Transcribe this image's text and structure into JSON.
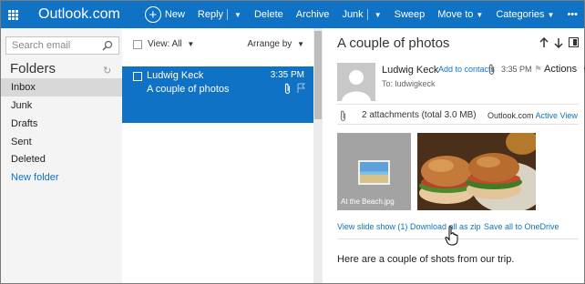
{
  "app": {
    "brand": "Outlook.com"
  },
  "toolbar": {
    "new": "New",
    "reply": "Reply",
    "delete": "Delete",
    "archive": "Archive",
    "junk": "Junk",
    "sweep": "Sweep",
    "move_to": "Move to",
    "categories": "Categories",
    "more": "•••"
  },
  "sidebar": {
    "search_placeholder": "Search email",
    "folders_heading": "Folders",
    "folders": [
      "Inbox",
      "Junk",
      "Drafts",
      "Sent",
      "Deleted"
    ],
    "new_folder": "New folder"
  },
  "message_list": {
    "view_label": "View: All",
    "arrange_label": "Arrange by",
    "messages": [
      {
        "sender": "Ludwig Keck",
        "subject": "A couple of photos",
        "time": "3:35 PM"
      }
    ]
  },
  "reading_pane": {
    "subject": "A couple of photos",
    "from_name": "Ludwig Keck",
    "add_to_contacts": "Add to contacts",
    "time": "3:35 PM",
    "actions": "Actions",
    "to_line": "To: ludwigkeck",
    "attachments_summary": "2 attachments (total 3.0 MB)",
    "attachments_source": "Outlook.com",
    "active_view": "Active View",
    "attachment_caption": "At the Beach.jpg",
    "links": {
      "slide_show": "View slide show (1)",
      "download_zip": "Download all as zip",
      "save_onedrive": "Save all to OneDrive"
    },
    "body": "Here are a couple of shots from our trip."
  },
  "colors": {
    "accent": "#0f72c5",
    "sidebar_bg": "#f4f4f4",
    "selected_folder": "#d8d8d8"
  },
  "icons": [
    "app-launcher-icon",
    "add-circle-icon",
    "search-icon",
    "refresh-icon",
    "paperclip-icon",
    "flag-icon",
    "arrow-up-icon",
    "arrow-down-icon",
    "pop-out-icon",
    "avatar-placeholder",
    "hand-cursor-icon"
  ]
}
